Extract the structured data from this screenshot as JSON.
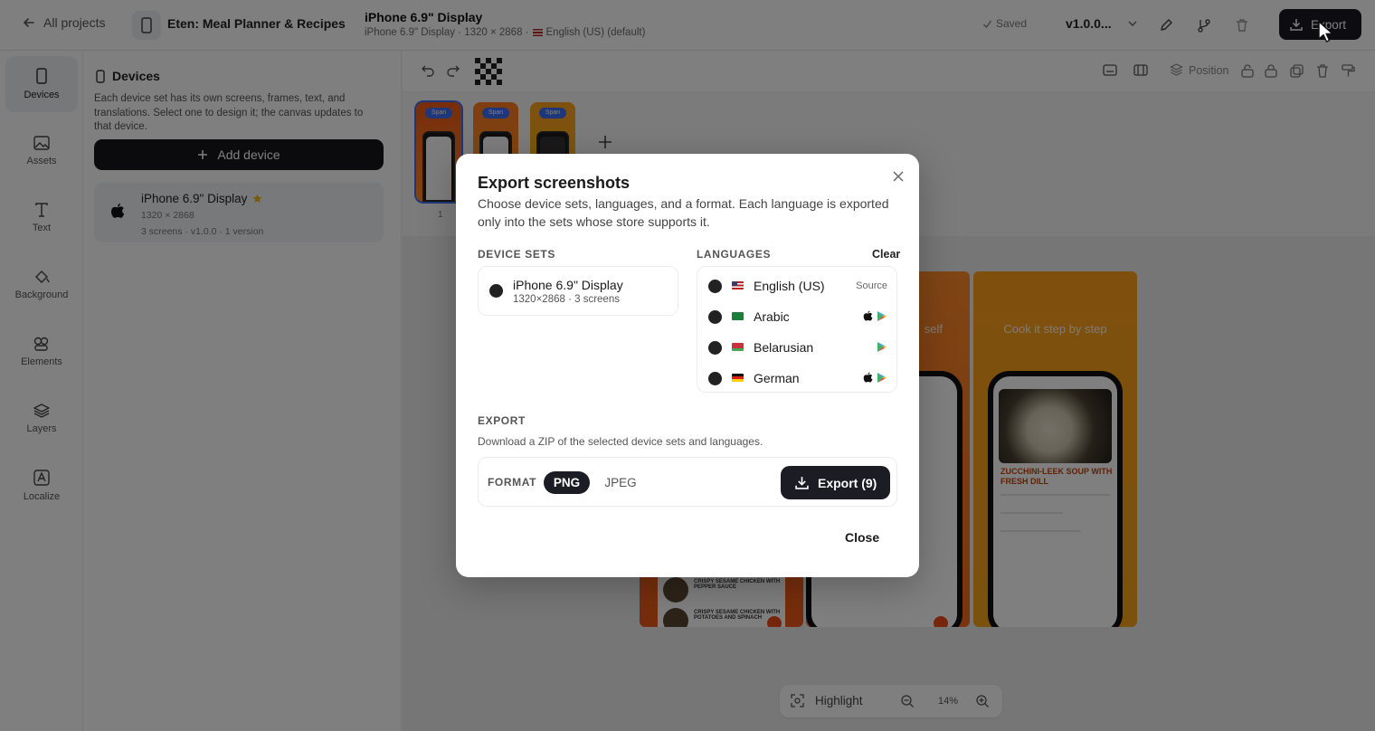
{
  "header": {
    "back_label": "All projects",
    "app_name": "Eten: Meal Planner & Recipes",
    "doc_title": "iPhone 6.9\" Display",
    "doc_subtitle_a": "iPhone 6.9\" Display · 1320 × 2868 ·",
    "doc_subtitle_b": "English (US) (default)",
    "saved_label": "Saved",
    "version": "v1.0.0...",
    "export_label": "Export"
  },
  "rail": {
    "items": [
      {
        "label": "Devices",
        "icon": "phone-icon"
      },
      {
        "label": "Assets",
        "icon": "image-icon"
      },
      {
        "label": "Text",
        "icon": "text-icon"
      },
      {
        "label": "Background",
        "icon": "paint-bucket-icon"
      },
      {
        "label": "Elements",
        "icon": "shapes-icon"
      },
      {
        "label": "Layers",
        "icon": "layers-icon"
      },
      {
        "label": "Localize",
        "icon": "translate-icon"
      }
    ]
  },
  "panel": {
    "title": "Devices",
    "description": "Each device set has its own screens, frames, text, and translations. Select one to design it; the canvas updates to that device.",
    "add_label": "Add device",
    "device": {
      "name": "iPhone 6.9\" Display",
      "resolution": "1320 × 2868",
      "meta": "3 screens · v1.0.0 · 1 version"
    }
  },
  "toolbar": {
    "position_label": "Position"
  },
  "thumbnails": {
    "badge": "Span",
    "index": "1"
  },
  "canvas": {
    "caption_2": "self",
    "caption_3": "Cook it step by step",
    "soup_title": "ZUCCHINI-LEEK SOUP WITH FRESH DILL",
    "item_1": "CRISPY SESAME CHICKEN WITH PEPPER SAUCE",
    "item_2": "CRISPY SESAME CHICKEN WITH POTATOES AND SPINACH"
  },
  "bottombar": {
    "highlight_label": "Highlight",
    "zoom": "14%"
  },
  "modal": {
    "title": "Export screenshots",
    "description": "Choose device sets, languages, and a format. Each language is exported only into the sets whose store supports it.",
    "device_sets_heading": "DEVICE SETS",
    "languages_heading": "LANGUAGES",
    "clear_label": "Clear",
    "device_set": {
      "name": "iPhone 6.9\" Display",
      "meta": "1320×2868 · 3 screens"
    },
    "languages": [
      {
        "name": "English (US)",
        "tag": "Source",
        "apple": false,
        "google": false
      },
      {
        "name": "Arabic",
        "tag": "",
        "apple": true,
        "google": true
      },
      {
        "name": "Belarusian",
        "tag": "",
        "apple": false,
        "google": true
      },
      {
        "name": "German",
        "tag": "",
        "apple": true,
        "google": true
      }
    ],
    "export_heading": "EXPORT",
    "export_description": "Download a ZIP of the selected device sets and languages.",
    "format_label": "FORMAT",
    "format_png": "PNG",
    "format_jpeg": "JPEG",
    "export_button": "Export (9)",
    "close_label": "Close"
  },
  "colors": {
    "accent": "#1c1c24",
    "canvas_orange": "#ef5a16",
    "canvas_yellow": "#f6a21c"
  }
}
